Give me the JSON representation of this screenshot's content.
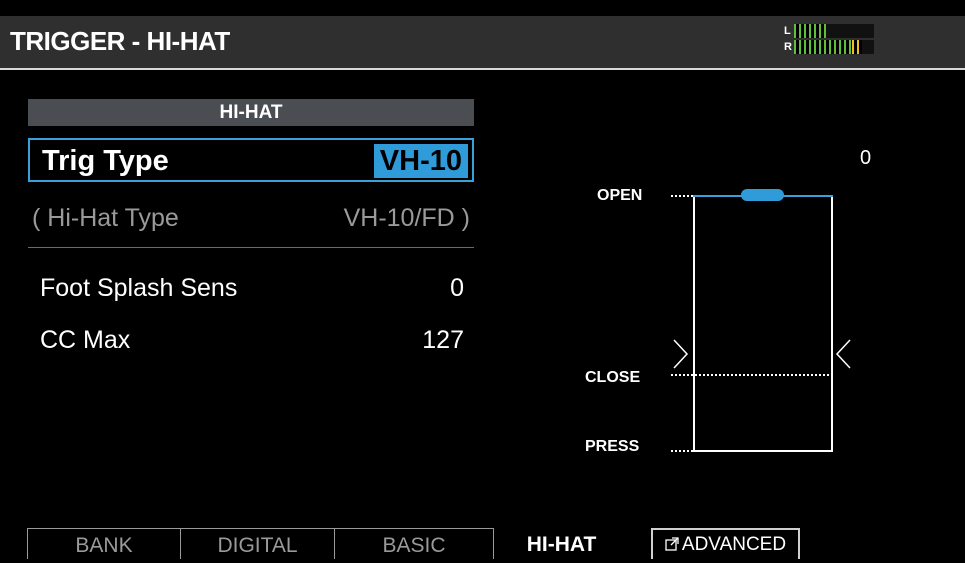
{
  "header": {
    "title": "TRIGGER - HI-HAT",
    "meter": {
      "left_label": "L",
      "right_label": "R",
      "left_level": 0.4,
      "right_level": 0.85
    }
  },
  "panel": {
    "section_title": "HI-HAT",
    "trig_type": {
      "label": "Trig Type",
      "value": "VH-10"
    },
    "hihat_type": {
      "label": "( Hi-Hat Type",
      "value": "VH-10/FD )"
    },
    "foot_splash_sens": {
      "label": "Foot Splash Sens",
      "value": "0"
    },
    "cc_max": {
      "label": "CC Max",
      "value": "127"
    }
  },
  "graph": {
    "value": "0",
    "open_label": "OPEN",
    "close_label": "CLOSE",
    "press_label": "PRESS"
  },
  "tabs": {
    "bank": "BANK",
    "digital": "DIGITAL",
    "basic": "BASIC",
    "hihat": "HI-HAT",
    "advanced": "ADVANCED"
  },
  "colors": {
    "accent": "#2f9bd8",
    "header_bg": "#2f2f2f",
    "section_bg": "#4a4e53",
    "meter_green": "#5fbf3a",
    "meter_peak": "#f0c020"
  }
}
